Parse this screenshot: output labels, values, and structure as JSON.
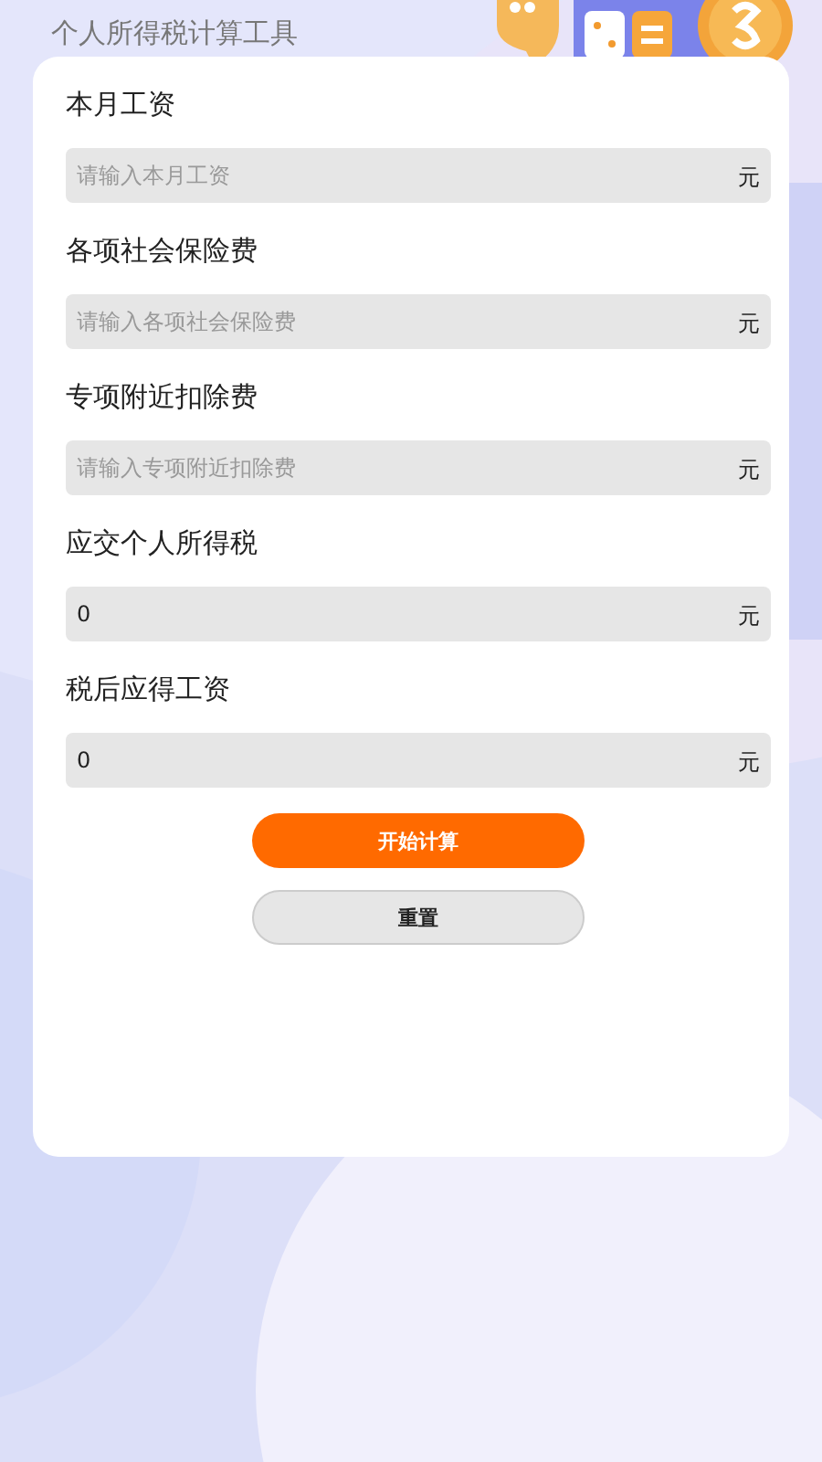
{
  "header": {
    "title": "个人所得税计算工具"
  },
  "fields": [
    {
      "label": "本月工资",
      "placeholder": "请输入本月工资",
      "unit": "元"
    },
    {
      "label": "各项社会保险费",
      "placeholder": "请输入各项社会保险费",
      "unit": "元"
    },
    {
      "label": "专项附近扣除费",
      "placeholder": "请输入专项附近扣除费",
      "unit": "元"
    },
    {
      "label": "应交个人所得税",
      "value": "0",
      "unit": "元"
    },
    {
      "label": "税后应得工资",
      "value": "0",
      "unit": "元"
    }
  ],
  "buttons": [
    {
      "label": "开始计算",
      "kind": "primary"
    },
    {
      "label": "重置",
      "kind": "secondary"
    }
  ]
}
